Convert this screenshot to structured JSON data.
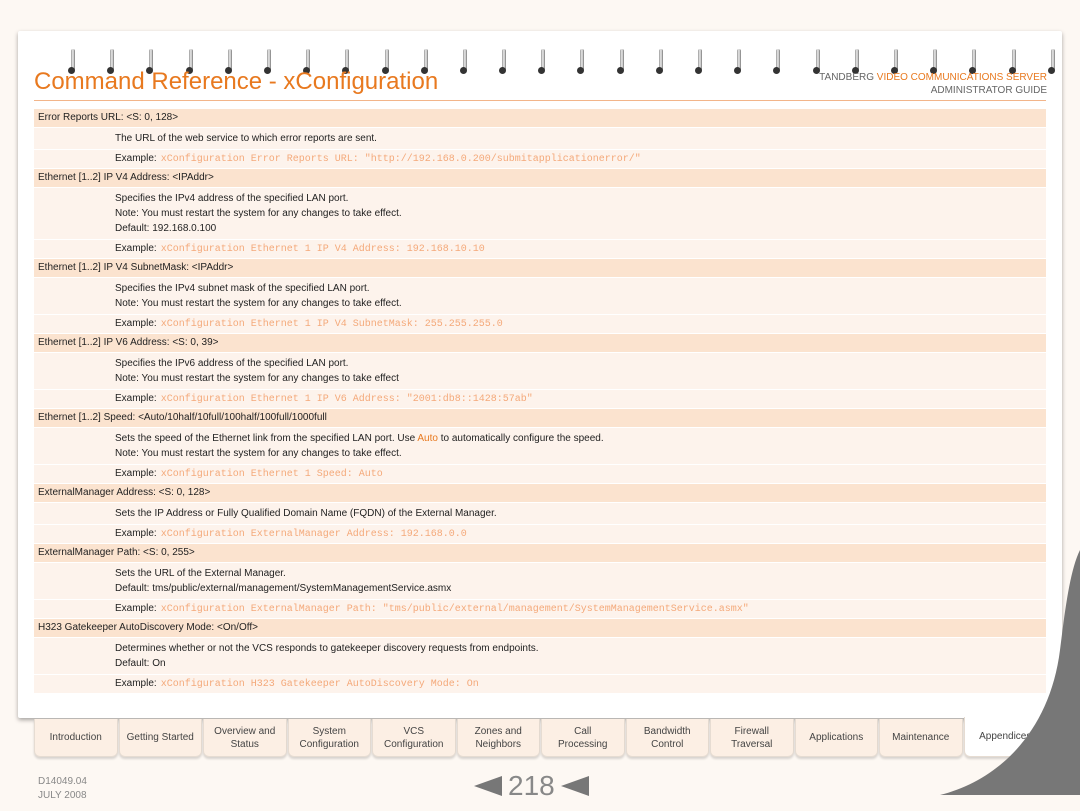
{
  "header": {
    "title": "Command Reference - xConfiguration",
    "brand_prefix": "TANDBERG ",
    "brand_product": "VIDEO COMMUNICATIONS SERVER",
    "brand_sub": "ADMINISTRATOR GUIDE"
  },
  "example_label": "Example:",
  "entries": [
    {
      "heading": "Error Reports URL: <S: 0, 128>",
      "lines": [
        "The URL of the web service to which error reports are sent."
      ],
      "example": "xConfiguration Error Reports URL: \"http://192.168.0.200/submitapplicationerror/\""
    },
    {
      "heading": "Ethernet [1..2] IP V4 Address: <IPAddr>",
      "lines": [
        "Specifies the IPv4 address of the specified LAN port.",
        "Note: You must restart the system for any changes to take effect.",
        "Default: 192.168.0.100"
      ],
      "example": "xConfiguration Ethernet 1 IP V4 Address: 192.168.10.10"
    },
    {
      "heading": "Ethernet [1..2] IP V4 SubnetMask: <IPAddr>",
      "lines": [
        "Specifies the IPv4 subnet mask of the specified LAN port.",
        "Note: You must restart the system for any changes to take effect."
      ],
      "example": "xConfiguration Ethernet 1 IP V4 SubnetMask: 255.255.255.0"
    },
    {
      "heading": "Ethernet [1..2] IP V6 Address: <S: 0, 39>",
      "lines": [
        "Specifies the IPv6 address of the specified LAN port.",
        "Note: You must restart the system for any changes to take effect"
      ],
      "example": "xConfiguration Ethernet 1 IP V6 Address: \"2001:db8::1428:57ab\""
    },
    {
      "heading": "Ethernet [1..2] Speed: <Auto/10half/10full/100half/100full/1000full",
      "lines_rich": {
        "pre": "Sets the speed of the Ethernet link from the specified LAN port. Use ",
        "hl": "Auto",
        "post": " to automatically configure the speed."
      },
      "lines": [
        "Note: You must restart the system for any changes to take effect."
      ],
      "example": "xConfiguration Ethernet 1 Speed: Auto"
    },
    {
      "heading": "ExternalManager Address: <S: 0, 128>",
      "lines": [
        "Sets the IP Address or Fully Qualified Domain Name (FQDN) of the External Manager."
      ],
      "example": "xConfiguration ExternalManager Address: 192.168.0.0"
    },
    {
      "heading": "ExternalManager Path: <S: 0, 255>",
      "lines": [
        "Sets the URL of the External Manager.",
        "Default: tms/public/external/management/SystemManagementService.asmx"
      ],
      "example": "xConfiguration ExternalManager Path: \"tms/public/external/management/SystemManagementService.asmx\""
    },
    {
      "heading": "H323 Gatekeeper AutoDiscovery Mode: <On/Off>",
      "lines": [
        "Determines whether or not the VCS responds to gatekeeper discovery requests from endpoints.",
        "Default: On"
      ],
      "example": "xConfiguration H323 Gatekeeper AutoDiscovery Mode: On"
    }
  ],
  "tabs": [
    {
      "l1": "Introduction",
      "l2": ""
    },
    {
      "l1": "Getting Started",
      "l2": ""
    },
    {
      "l1": "Overview and",
      "l2": "Status"
    },
    {
      "l1": "System",
      "l2": "Configuration"
    },
    {
      "l1": "VCS",
      "l2": "Configuration"
    },
    {
      "l1": "Zones and",
      "l2": "Neighbors"
    },
    {
      "l1": "Call",
      "l2": "Processing"
    },
    {
      "l1": "Bandwidth",
      "l2": "Control"
    },
    {
      "l1": "Firewall",
      "l2": "Traversal"
    },
    {
      "l1": "Applications",
      "l2": ""
    },
    {
      "l1": "Maintenance",
      "l2": ""
    },
    {
      "l1": "Appendices",
      "l2": "",
      "active": true
    }
  ],
  "footer": {
    "doc_id": "D14049.04",
    "date": "JULY 2008",
    "page": "218"
  },
  "colors": {
    "accent": "#e8791f",
    "heading_bg": "#fbe3cf",
    "body_bg": "#fdf3ec",
    "code": "#f4a97a"
  }
}
